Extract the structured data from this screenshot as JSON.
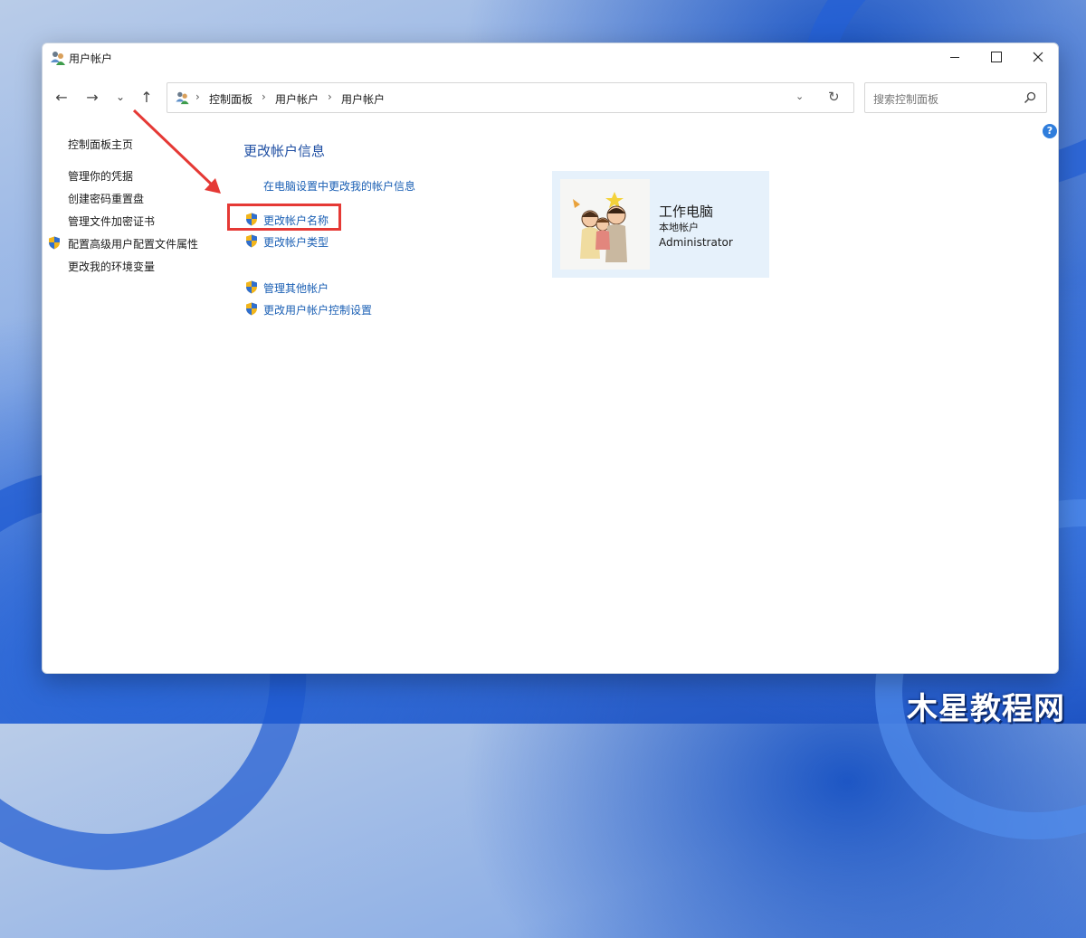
{
  "window": {
    "title": "用户帐户",
    "controls": {
      "minimize": "minimize-icon",
      "maximize": "maximize-icon",
      "close": "close-icon"
    }
  },
  "nav": {
    "back": "←",
    "forward": "→",
    "recent": "⌄",
    "up": "↑",
    "breadcrumb": [
      "控制面板",
      "用户帐户",
      "用户帐户"
    ],
    "search_placeholder": "搜索控制面板"
  },
  "sidebar": {
    "items": [
      {
        "label": "控制面板主页",
        "shield": false
      },
      {
        "label": "管理你的凭据",
        "shield": false
      },
      {
        "label": "创建密码重置盘",
        "shield": false
      },
      {
        "label": "管理文件加密证书",
        "shield": false
      },
      {
        "label": "配置高级用户配置文件属性",
        "shield": true
      },
      {
        "label": "更改我的环境变量",
        "shield": false
      }
    ]
  },
  "main": {
    "heading": "更改帐户信息",
    "tasks": [
      {
        "label": "在电脑设置中更改我的帐户信息",
        "shield": false
      },
      {
        "label": "更改帐户名称",
        "shield": true,
        "highlighted": true
      },
      {
        "label": "更改帐户类型",
        "shield": true
      },
      {
        "label": "管理其他帐户",
        "shield": true
      },
      {
        "label": "更改用户帐户控制设置",
        "shield": true
      }
    ]
  },
  "account": {
    "name": "工作电脑",
    "type": "本地帐户",
    "role": "Administrator"
  },
  "colors": {
    "link": "#1a5fb4",
    "heading": "#1f4fa3",
    "highlight": "#e53935",
    "card_bg": "#e6f1fb"
  },
  "watermark": "木星教程网"
}
